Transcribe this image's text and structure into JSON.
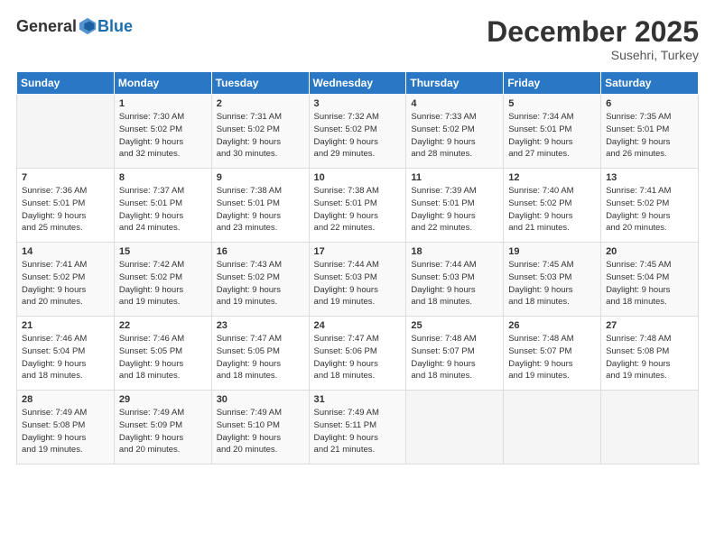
{
  "logo": {
    "general": "General",
    "blue": "Blue"
  },
  "header": {
    "month": "December 2025",
    "location": "Susehri, Turkey"
  },
  "days_of_week": [
    "Sunday",
    "Monday",
    "Tuesday",
    "Wednesday",
    "Thursday",
    "Friday",
    "Saturday"
  ],
  "weeks": [
    [
      {
        "day": "",
        "info": ""
      },
      {
        "day": "1",
        "info": "Sunrise: 7:30 AM\nSunset: 5:02 PM\nDaylight: 9 hours\nand 32 minutes."
      },
      {
        "day": "2",
        "info": "Sunrise: 7:31 AM\nSunset: 5:02 PM\nDaylight: 9 hours\nand 30 minutes."
      },
      {
        "day": "3",
        "info": "Sunrise: 7:32 AM\nSunset: 5:02 PM\nDaylight: 9 hours\nand 29 minutes."
      },
      {
        "day": "4",
        "info": "Sunrise: 7:33 AM\nSunset: 5:02 PM\nDaylight: 9 hours\nand 28 minutes."
      },
      {
        "day": "5",
        "info": "Sunrise: 7:34 AM\nSunset: 5:01 PM\nDaylight: 9 hours\nand 27 minutes."
      },
      {
        "day": "6",
        "info": "Sunrise: 7:35 AM\nSunset: 5:01 PM\nDaylight: 9 hours\nand 26 minutes."
      }
    ],
    [
      {
        "day": "7",
        "info": "Sunrise: 7:36 AM\nSunset: 5:01 PM\nDaylight: 9 hours\nand 25 minutes."
      },
      {
        "day": "8",
        "info": "Sunrise: 7:37 AM\nSunset: 5:01 PM\nDaylight: 9 hours\nand 24 minutes."
      },
      {
        "day": "9",
        "info": "Sunrise: 7:38 AM\nSunset: 5:01 PM\nDaylight: 9 hours\nand 23 minutes."
      },
      {
        "day": "10",
        "info": "Sunrise: 7:38 AM\nSunset: 5:01 PM\nDaylight: 9 hours\nand 22 minutes."
      },
      {
        "day": "11",
        "info": "Sunrise: 7:39 AM\nSunset: 5:01 PM\nDaylight: 9 hours\nand 22 minutes."
      },
      {
        "day": "12",
        "info": "Sunrise: 7:40 AM\nSunset: 5:02 PM\nDaylight: 9 hours\nand 21 minutes."
      },
      {
        "day": "13",
        "info": "Sunrise: 7:41 AM\nSunset: 5:02 PM\nDaylight: 9 hours\nand 20 minutes."
      }
    ],
    [
      {
        "day": "14",
        "info": "Sunrise: 7:41 AM\nSunset: 5:02 PM\nDaylight: 9 hours\nand 20 minutes."
      },
      {
        "day": "15",
        "info": "Sunrise: 7:42 AM\nSunset: 5:02 PM\nDaylight: 9 hours\nand 19 minutes."
      },
      {
        "day": "16",
        "info": "Sunrise: 7:43 AM\nSunset: 5:02 PM\nDaylight: 9 hours\nand 19 minutes."
      },
      {
        "day": "17",
        "info": "Sunrise: 7:44 AM\nSunset: 5:03 PM\nDaylight: 9 hours\nand 19 minutes."
      },
      {
        "day": "18",
        "info": "Sunrise: 7:44 AM\nSunset: 5:03 PM\nDaylight: 9 hours\nand 18 minutes."
      },
      {
        "day": "19",
        "info": "Sunrise: 7:45 AM\nSunset: 5:03 PM\nDaylight: 9 hours\nand 18 minutes."
      },
      {
        "day": "20",
        "info": "Sunrise: 7:45 AM\nSunset: 5:04 PM\nDaylight: 9 hours\nand 18 minutes."
      }
    ],
    [
      {
        "day": "21",
        "info": "Sunrise: 7:46 AM\nSunset: 5:04 PM\nDaylight: 9 hours\nand 18 minutes."
      },
      {
        "day": "22",
        "info": "Sunrise: 7:46 AM\nSunset: 5:05 PM\nDaylight: 9 hours\nand 18 minutes."
      },
      {
        "day": "23",
        "info": "Sunrise: 7:47 AM\nSunset: 5:05 PM\nDaylight: 9 hours\nand 18 minutes."
      },
      {
        "day": "24",
        "info": "Sunrise: 7:47 AM\nSunset: 5:06 PM\nDaylight: 9 hours\nand 18 minutes."
      },
      {
        "day": "25",
        "info": "Sunrise: 7:48 AM\nSunset: 5:07 PM\nDaylight: 9 hours\nand 18 minutes."
      },
      {
        "day": "26",
        "info": "Sunrise: 7:48 AM\nSunset: 5:07 PM\nDaylight: 9 hours\nand 19 minutes."
      },
      {
        "day": "27",
        "info": "Sunrise: 7:48 AM\nSunset: 5:08 PM\nDaylight: 9 hours\nand 19 minutes."
      }
    ],
    [
      {
        "day": "28",
        "info": "Sunrise: 7:49 AM\nSunset: 5:08 PM\nDaylight: 9 hours\nand 19 minutes."
      },
      {
        "day": "29",
        "info": "Sunrise: 7:49 AM\nSunset: 5:09 PM\nDaylight: 9 hours\nand 20 minutes."
      },
      {
        "day": "30",
        "info": "Sunrise: 7:49 AM\nSunset: 5:10 PM\nDaylight: 9 hours\nand 20 minutes."
      },
      {
        "day": "31",
        "info": "Sunrise: 7:49 AM\nSunset: 5:11 PM\nDaylight: 9 hours\nand 21 minutes."
      },
      {
        "day": "",
        "info": ""
      },
      {
        "day": "",
        "info": ""
      },
      {
        "day": "",
        "info": ""
      }
    ]
  ]
}
